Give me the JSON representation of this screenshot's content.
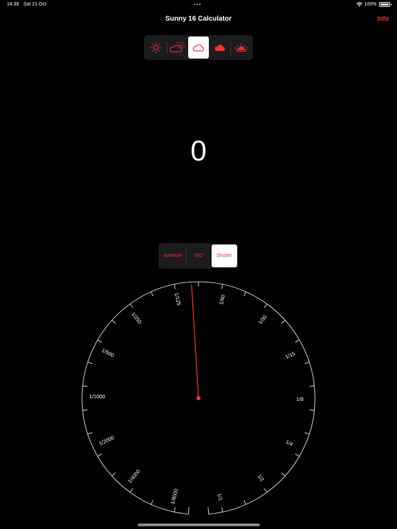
{
  "status_bar": {
    "time": "14:39",
    "date": "Sat 21 Oct",
    "battery": "100%"
  },
  "header": {
    "title": "Sunny 16 Calculator",
    "info_label": "Info"
  },
  "weather": {
    "options": [
      "sunny",
      "slight-overcast",
      "overcast",
      "heavy-overcast",
      "sunset"
    ],
    "selected_index": 2,
    "accent": "#ff2d2d"
  },
  "ev_value": "0",
  "mode": {
    "options": [
      "Aperture",
      "ISO",
      "Shutter"
    ],
    "selected": "Shutter"
  },
  "dial": {
    "labels": [
      "1/125",
      "1/60",
      "1/30",
      "1/15",
      "1/8",
      "1/4",
      "1/2",
      "1/1",
      "1/8000",
      "1/4000",
      "1/2000",
      "1/1000",
      "1/500",
      "1/250"
    ],
    "needle_color": "#ff2d2d"
  }
}
